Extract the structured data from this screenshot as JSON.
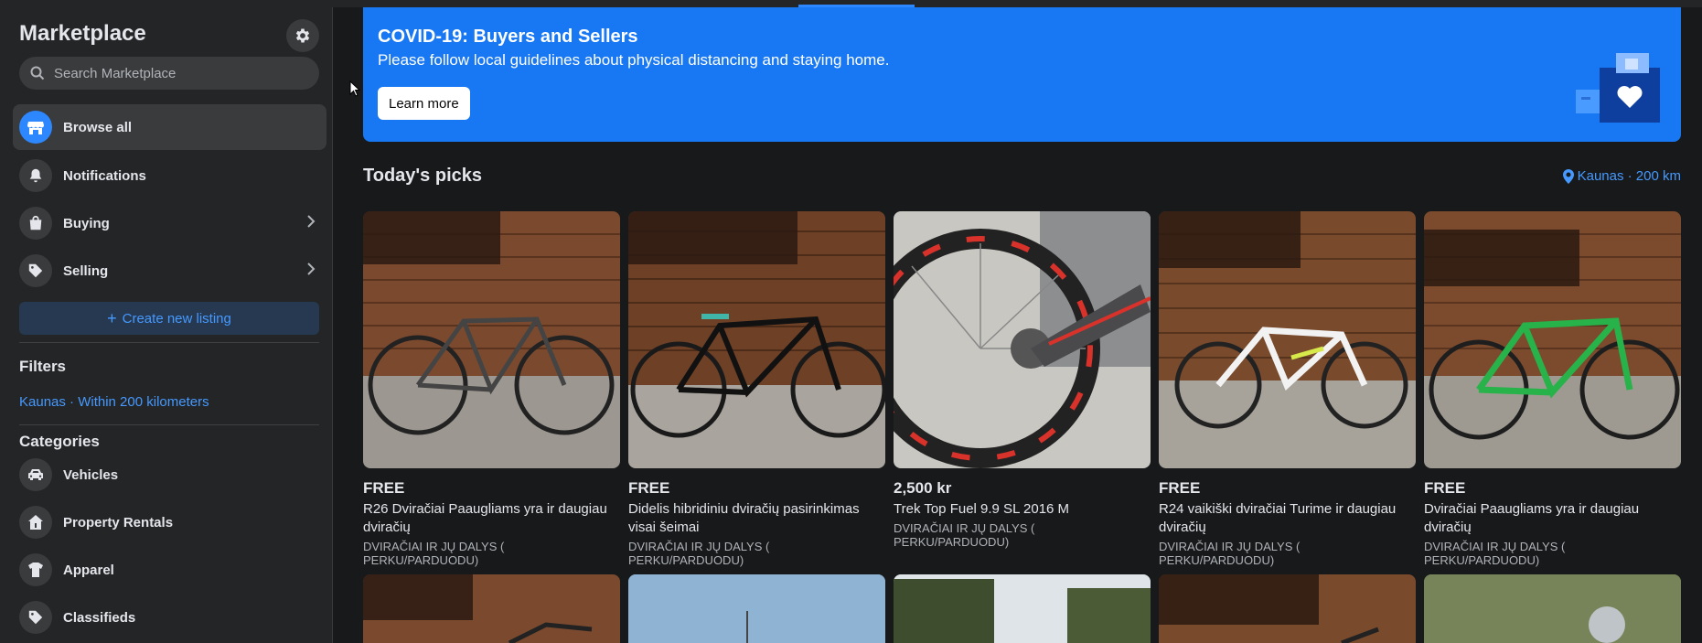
{
  "sidebar": {
    "title": "Marketplace",
    "search_placeholder": "Search Marketplace",
    "nav": [
      {
        "label": "Browse all",
        "icon": "storefront-icon",
        "active": true
      },
      {
        "label": "Notifications",
        "icon": "bell-icon"
      },
      {
        "label": "Buying",
        "icon": "shopping-bag-icon"
      },
      {
        "label": "Selling",
        "icon": "price-tag-icon"
      }
    ],
    "create_listing": "Create new listing",
    "filters_heading": "Filters",
    "filter_location": "Kaunas · Within 200 kilometers",
    "categories_heading": "Categories",
    "categories": [
      {
        "label": "Vehicles",
        "icon": "car-icon"
      },
      {
        "label": "Property Rentals",
        "icon": "house-icon"
      },
      {
        "label": "Apparel",
        "icon": "tshirt-icon"
      },
      {
        "label": "Classifieds",
        "icon": "price-tag-icon"
      }
    ]
  },
  "banner": {
    "title": "COVID-19: Buyers and Sellers",
    "subtitle": "Please follow local guidelines about physical distancing and staying home.",
    "button": "Learn more"
  },
  "picks": {
    "heading": "Today's picks",
    "location": "Kaunas · 200 km",
    "listings": [
      {
        "price": "FREE",
        "title": "R26 Dviračiai Paaugliams yra ir daugiau dviračių",
        "category": "DVIRAČIAI IR JŲ DALYS ( PERKU/PARDUODU)"
      },
      {
        "price": "FREE",
        "title": "Didelis hibridiniu dviračių pasirinkimas visai šeimai",
        "category": "DVIRAČIAI IR JŲ DALYS ( PERKU/PARDUODU)"
      },
      {
        "price": "2,500 kr",
        "title": "Trek Top Fuel 9.9 SL 2016 M",
        "category": "DVIRAČIAI IR JŲ DALYS ( PERKU/PARDUODU)"
      },
      {
        "price": "FREE",
        "title": "R24 vaikiški dviračiai Turime ir daugiau dviračių",
        "category": "DVIRAČIAI IR JŲ DALYS ( PERKU/PARDUODU)"
      },
      {
        "price": "FREE",
        "title": "Dviračiai Paaugliams yra ir daugiau dviračių",
        "category": "DVIRAČIAI IR JŲ DALYS ( PERKU/PARDUODU)"
      }
    ]
  },
  "colors": {
    "accent": "#2d88ff",
    "banner": "#1877f2",
    "background": "#18191a",
    "surface": "#242526"
  }
}
